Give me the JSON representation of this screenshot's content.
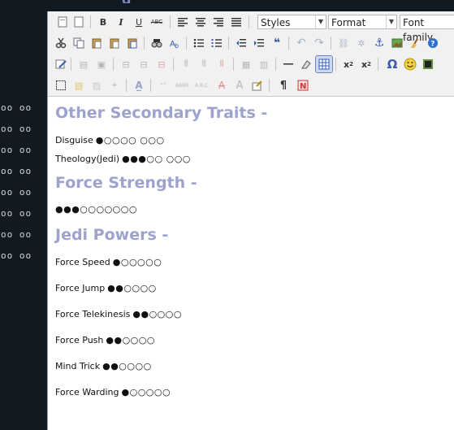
{
  "background_fragment": {
    "heading_tail": "g"
  },
  "left_dots": [
    "oo  oo",
    "oo  oo",
    "oo  oo",
    "oo  oo",
    "oo  oo",
    "oo  oo",
    "oo  oo",
    "oo  oo"
  ],
  "toolbar": {
    "styles_label": "Styles",
    "format_label": "Format",
    "font_family_label": "Font family",
    "row1_icons": [
      "new-document-icon",
      "bold-icon",
      "italic-icon",
      "underline-icon",
      "strikethrough-icon",
      "align-left-icon",
      "align-center-icon",
      "align-right-icon",
      "align-justify-icon"
    ],
    "row1_text": {
      "bold": "B",
      "italic": "I",
      "underline": "U",
      "strike": "ABC"
    }
  },
  "content": {
    "sections": [
      {
        "heading": "Other Secondary Traits -"
      },
      {
        "heading": "Force Strength -"
      },
      {
        "heading": "Jedi Powers -"
      }
    ],
    "secondary_traits": [
      {
        "name": "Disguise",
        "rating": "●○○○○  ○○○"
      },
      {
        "name": "Theology(Jedi)",
        "rating": "●●●○○  ○○○"
      }
    ],
    "force_strength_rating": "●●●○○○○○○○",
    "jedi_powers": [
      {
        "name": "Force Speed",
        "rating": "●○○○○○"
      },
      {
        "name": "Force Jump",
        "rating": "●●○○○○"
      },
      {
        "name": "Force Telekinesis",
        "rating": "●●○○○○"
      },
      {
        "name": "Force Push",
        "rating": "●●○○○○"
      },
      {
        "name": "Mind Trick",
        "rating": "●●○○○○"
      },
      {
        "name": "Force Warding",
        "rating": "●○○○○○"
      }
    ]
  }
}
